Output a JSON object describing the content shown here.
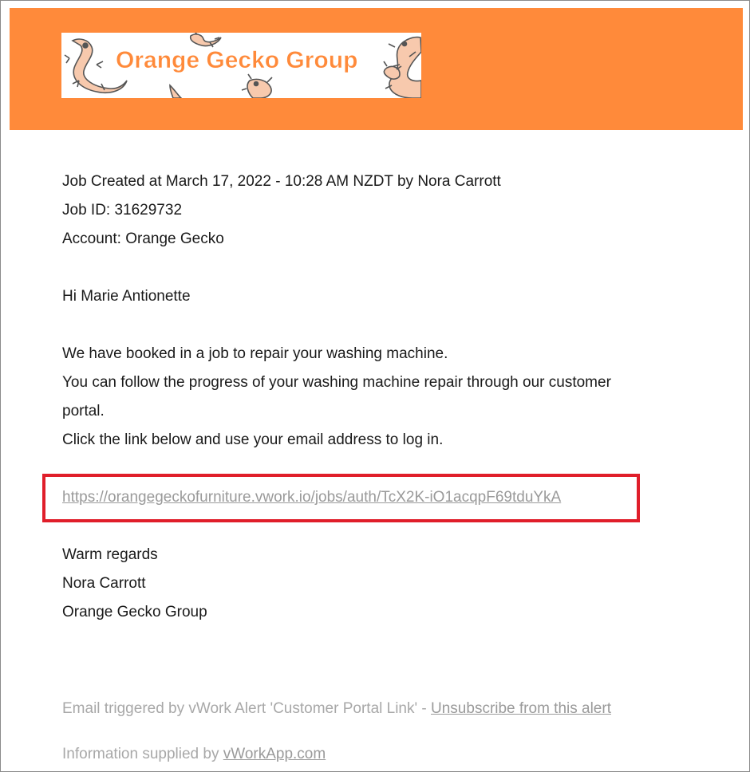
{
  "header": {
    "brand_color": "#ff8a3a",
    "logo_text": "Orange Gecko Group"
  },
  "email": {
    "meta": {
      "created": "Job Created at March 17, 2022 - 10:28 AM NZDT by Nora Carrott",
      "job_id": "Job ID: 31629732",
      "account": "Account: Orange Gecko"
    },
    "greeting": "Hi Marie Antionette",
    "body": {
      "line1": "We have booked in a job to repair your washing machine.",
      "line2": "You can follow the progress of your washing machine repair through our customer",
      "line3": "portal.",
      "line4": "Click the link below and use your email address to log in."
    },
    "portal_link": "https://orangegeckofurniture.vwork.io/jobs/auth/TcX2K-iO1acqpF69tduYkA",
    "highlight_color": "#e01e2a",
    "signoff": {
      "regards": "Warm regards",
      "name": "Nora Carrott",
      "company": "Orange Gecko Group"
    }
  },
  "footer": {
    "trigger_text": "Email triggered by vWork Alert 'Customer Portal Link' - ",
    "unsubscribe_link": "Unsubscribe from this alert",
    "supplied_text": "Information supplied by ",
    "supplied_link": "vWorkApp.com"
  }
}
